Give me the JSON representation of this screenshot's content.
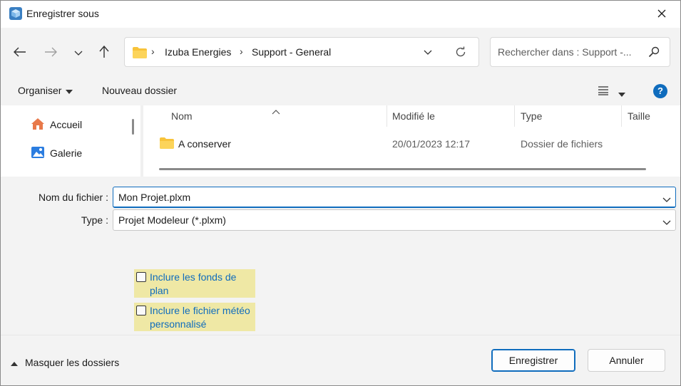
{
  "window": {
    "title": "Enregistrer sous"
  },
  "navigation": {
    "breadcrumbs": [
      "Izuba Energies",
      "Support - General"
    ],
    "search_placeholder": "Rechercher dans : Support -..."
  },
  "toolbar": {
    "organize_label": "Organiser",
    "new_folder_label": "Nouveau dossier"
  },
  "sidebar": {
    "items": [
      {
        "label": "Accueil",
        "icon": "home-icon"
      },
      {
        "label": "Galerie",
        "icon": "gallery-icon"
      }
    ]
  },
  "file_list": {
    "columns": [
      "Nom",
      "Modifié le",
      "Type",
      "Taille"
    ],
    "rows": [
      {
        "name": "A conserver",
        "modified": "20/01/2023 12:17",
        "type": "Dossier de fichiers",
        "size": ""
      }
    ]
  },
  "form": {
    "filename_label": "Nom du fichier :",
    "filename_value": "Mon Projet.plxm",
    "type_label": "Type :",
    "type_value": "Projet Modeleur (*.plxm)"
  },
  "options": {
    "include_backgrounds": {
      "label": "Inclure les fonds de plan",
      "checked": false
    },
    "include_weather": {
      "label": "Inclure le fichier météo personnalisé",
      "checked": false
    }
  },
  "footer": {
    "hide_folders_label": "Masquer les dossiers",
    "save_label": "Enregistrer",
    "cancel_label": "Annuler"
  },
  "colors": {
    "accent": "#0f6cbd",
    "panel_bg": "#f3f3f3",
    "option_highlight": "#efe8a5",
    "folder_yellow": "#f8c33a"
  }
}
